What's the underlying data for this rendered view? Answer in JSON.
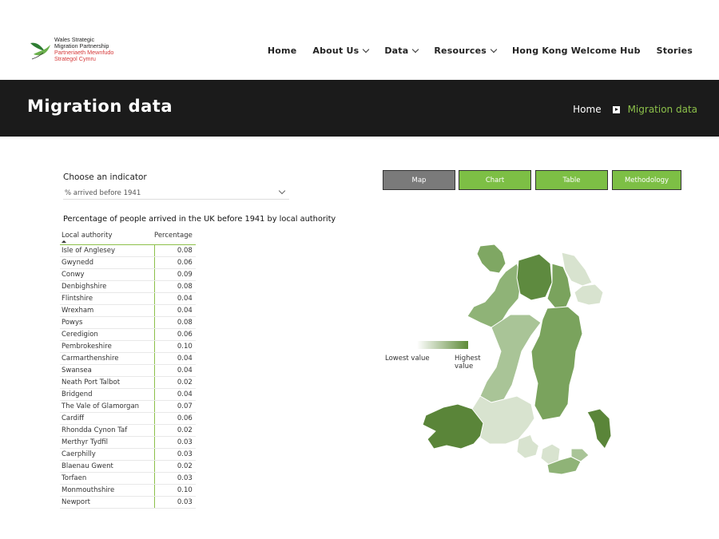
{
  "logo": {
    "en_line1": "Wales Strategic",
    "en_line2": "Migration Partnership",
    "cy_line1": "Partneriaeth Mewnfudo",
    "cy_line2": "Strategol Cymru"
  },
  "nav": {
    "items": [
      {
        "label": "Home"
      },
      {
        "label": "About Us"
      },
      {
        "label": "Data"
      },
      {
        "label": "Resources"
      },
      {
        "label": "Hong Kong Welcome Hub"
      },
      {
        "label": "Stories"
      }
    ]
  },
  "banner": {
    "title": "Migration data",
    "crumb_home": "Home",
    "crumb_current": "Migration data"
  },
  "colors": {
    "accent": "#8cc04a",
    "banner_bg": "#1b1b1b",
    "tab_active": "#7a7a7a",
    "tab_green": "#7dbf45"
  },
  "indicator": {
    "label": "Choose an indicator",
    "selected": "% arrived before 1941"
  },
  "tabs": [
    {
      "label": "Map"
    },
    {
      "label": "Chart"
    },
    {
      "label": "Table"
    },
    {
      "label": "Methodology"
    }
  ],
  "table": {
    "title": "Percentage of people arrived in the UK before 1941 by local authority",
    "col1": "Local authority",
    "col2": "Percentage",
    "rows": [
      {
        "name": "Isle of Anglesey",
        "value": "0.08"
      },
      {
        "name": "Gwynedd",
        "value": "0.06"
      },
      {
        "name": "Conwy",
        "value": "0.09"
      },
      {
        "name": "Denbighshire",
        "value": "0.08"
      },
      {
        "name": "Flintshire",
        "value": "0.04"
      },
      {
        "name": "Wrexham",
        "value": "0.04"
      },
      {
        "name": "Powys",
        "value": "0.08"
      },
      {
        "name": "Ceredigion",
        "value": "0.06"
      },
      {
        "name": "Pembrokeshire",
        "value": "0.10"
      },
      {
        "name": "Carmarthenshire",
        "value": "0.04"
      },
      {
        "name": "Swansea",
        "value": "0.04"
      },
      {
        "name": "Neath Port Talbot",
        "value": "0.02"
      },
      {
        "name": "Bridgend",
        "value": "0.04"
      },
      {
        "name": "The Vale of Glamorgan",
        "value": "0.07"
      },
      {
        "name": "Cardiff",
        "value": "0.06"
      },
      {
        "name": "Rhondda Cynon Taf",
        "value": "0.02"
      },
      {
        "name": "Merthyr Tydfil",
        "value": "0.03"
      },
      {
        "name": "Caerphilly",
        "value": "0.03"
      },
      {
        "name": "Blaenau Gwent",
        "value": "0.02"
      },
      {
        "name": "Torfaen",
        "value": "0.03"
      },
      {
        "name": "Monmouthshire",
        "value": "0.10"
      },
      {
        "name": "Newport",
        "value": "0.03"
      }
    ]
  },
  "legend": {
    "low": "Lowest value",
    "high": "Highest value"
  }
}
